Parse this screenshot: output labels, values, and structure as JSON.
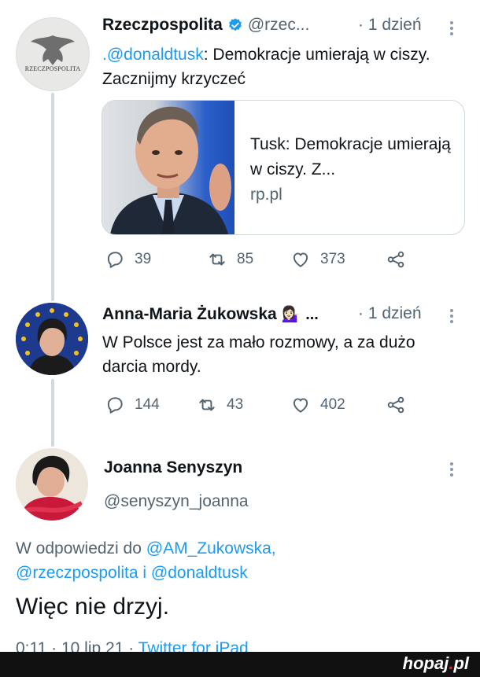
{
  "tweets": [
    {
      "name": "Rzeczpospolita",
      "handle": "@rzec...",
      "time": "· 1 dzień",
      "text_mention": ".@donaldtusk",
      "text_rest": ": Demokracje umierają w ciszy. Zacznijmy krzyczeć",
      "avatar_caption": "RZECZPOSPOLITA",
      "card": {
        "title": "Tusk: Demokracje umierają w ciszy. Z...",
        "domain": "rp.pl"
      },
      "actions": {
        "replies": "39",
        "retweets": "85",
        "likes": "373"
      }
    },
    {
      "name": "Anna-Maria Żukowska",
      "emoji": "💁🏻‍♀️ ...",
      "time": "· 1 dzień",
      "text": "W Polsce jest za mało rozmowy, a za dużo darcia mordy.",
      "actions": {
        "replies": "144",
        "retweets": "43",
        "likes": "402"
      }
    }
  ],
  "main_tweet": {
    "name": "Joanna Senyszyn",
    "handle": "@senyszyn_joanna",
    "reply_prefix": "W odpowiedzi do",
    "reply_user1": "@AM_Zukowska,",
    "reply_user2": "@rzeczpospolita",
    "reply_and": " i ",
    "reply_user3": "@donaldtusk",
    "text": "Więc nie drzyj.",
    "meta_time": "0:11 · 10 lip 21 · ",
    "meta_source": "Twitter for iPad"
  },
  "watermark": {
    "brand": "hopaj",
    "dot": ".",
    "tld": "pl"
  },
  "colors": {
    "link": "#1d9bf0",
    "muted": "#536471",
    "verified": "#1d9bf0"
  }
}
